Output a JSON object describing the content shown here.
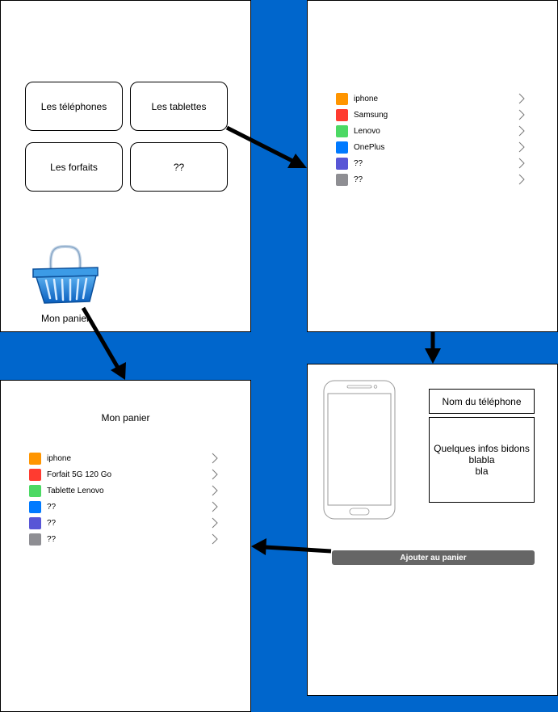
{
  "home": {
    "tiles": [
      "Les téléphones",
      "Les tablettes",
      "Les forfaits",
      "??"
    ],
    "basket_label": "Mon panier",
    "basket_icon": "basket-icon"
  },
  "brands": {
    "items": [
      {
        "label": "iphone",
        "color": "#ff9500"
      },
      {
        "label": "Samsung",
        "color": "#ff3b30"
      },
      {
        "label": "Lenovo",
        "color": "#4cd964"
      },
      {
        "label": "OnePlus",
        "color": "#007aff"
      },
      {
        "label": "??",
        "color": "#5856d6"
      },
      {
        "label": "??",
        "color": "#8e8e93"
      }
    ]
  },
  "cart": {
    "title": "Mon panier",
    "items": [
      {
        "label": "iphone",
        "color": "#ff9500"
      },
      {
        "label": "Forfait 5G 120 Go",
        "color": "#ff3b30"
      },
      {
        "label": "Tablette Lenovo",
        "color": "#4cd964"
      },
      {
        "label": "??",
        "color": "#007aff"
      },
      {
        "label": "??",
        "color": "#5856d6"
      },
      {
        "label": "??",
        "color": "#8e8e93"
      }
    ]
  },
  "detail": {
    "phone_name": "Nom du téléphone",
    "info_lines": [
      "Quelques infos bidons",
      "blabla",
      "bla"
    ],
    "add_button": "Ajouter au panier"
  },
  "colors": {
    "background": "#0066cc",
    "button": "#666666"
  }
}
